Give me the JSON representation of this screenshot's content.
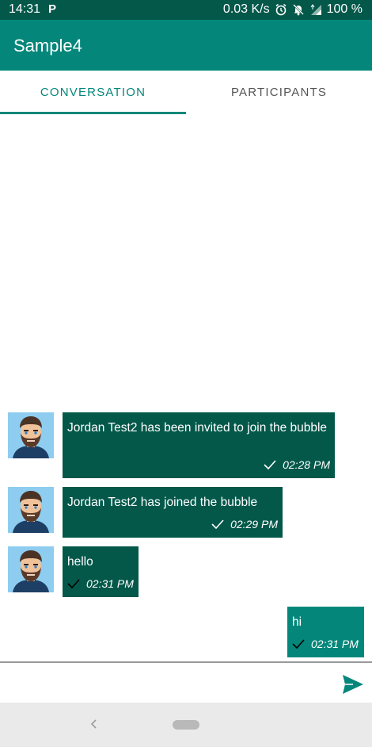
{
  "status_bar": {
    "time": "14:31",
    "notification_badge": "P",
    "network_speed": "0.03 K/s",
    "battery": "100 %",
    "icons": [
      "alarm-icon",
      "mute-icon",
      "signal-4g-icon",
      "battery-icon"
    ]
  },
  "app_bar": {
    "title": "Sample4"
  },
  "tabs": [
    {
      "label": "CONVERSATION",
      "active": true
    },
    {
      "label": "PARTICIPANTS",
      "active": false
    }
  ],
  "messages": [
    {
      "direction": "incoming",
      "text": "Jordan Test2 has been invited to join the bubble",
      "time": "02:28 PM",
      "delivered": true
    },
    {
      "direction": "incoming",
      "text": "Jordan Test2 has joined the bubble",
      "time": "02:29 PM",
      "delivered": true
    },
    {
      "direction": "incoming",
      "text": "hello",
      "time": "02:31 PM",
      "delivered": true
    },
    {
      "direction": "outgoing",
      "text": "hi",
      "time": "02:31 PM",
      "delivered": true
    }
  ],
  "composer": {
    "value": "",
    "placeholder": ""
  },
  "colors": {
    "status_bar": "#03584a",
    "app_bar": "#04877a",
    "incoming_bubble": "#03584a",
    "outgoing_bubble": "#04877a",
    "accent": "#04877a"
  }
}
